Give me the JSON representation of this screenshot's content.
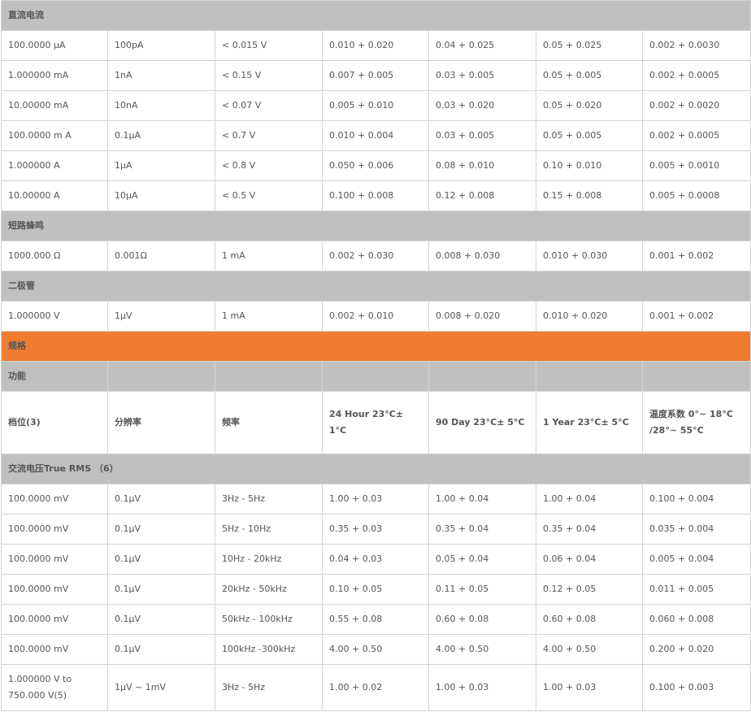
{
  "sections": {
    "dc_current": "直流电流",
    "continuity": "短路蜂鸣",
    "diode": "二极管",
    "spec": "规格",
    "function": "功能",
    "ac_voltage": "交流电压True RMS （6）"
  },
  "dc_current_rows": [
    [
      "100.0000 μA",
      "100pA",
      "< 0.015 V",
      "0.010 + 0.020",
      "0.04 + 0.025",
      "0.05 + 0.025",
      "0.002 + 0.0030"
    ],
    [
      "1.000000 mA",
      "1nA",
      "< 0.15 V",
      "0.007 + 0.005",
      "0.03 + 0.005",
      "0.05 + 0.005",
      "0.002 + 0.0005"
    ],
    [
      "10.00000 mA",
      "10nA",
      "< 0.07 V",
      "0.005 + 0.010",
      "0.03 + 0.020",
      "0.05 + 0.020",
      "0.002 + 0.0020"
    ],
    [
      "100.0000 m A",
      "0.1μA",
      "< 0.7 V",
      "0.010 + 0.004",
      "0.03 + 0.005",
      "0.05 + 0.005",
      "0.002 + 0.0005"
    ],
    [
      "1.000000 A",
      "1μA",
      "< 0.8 V",
      "0.050 + 0.006",
      "0.08 + 0.010",
      "0.10 + 0.010",
      "0.005 + 0.0010"
    ],
    [
      "10.00000 A",
      "10μA",
      "< 0.5 V",
      "0.100 + 0.008",
      "0.12 + 0.008",
      "0.15 + 0.008",
      "0.005 + 0.0008"
    ]
  ],
  "continuity_rows": [
    [
      "1000.000 Ω",
      "0.001Ω",
      "1 mA",
      "0.002 + 0.030",
      "0.008 + 0.030",
      "0.010 + 0.030",
      "0.001 + 0.002"
    ]
  ],
  "diode_rows": [
    [
      "1.000000 V",
      "1μV",
      "1 mA",
      "0.002 + 0.010",
      "0.008 + 0.020",
      "0.010 + 0.020",
      "0.001 + 0.002"
    ]
  ],
  "column_headers": [
    "档位(3)",
    "分辨率",
    "频率",
    "24 Hour 23°C± 1°C",
    "90 Day 23°C± 5°C",
    "1 Year 23°C± 5°C",
    "温度系数 0°~ 18°C /28°~ 55°C"
  ],
  "ac_voltage_rows": [
    [
      "100.0000 mV",
      "0.1μV",
      "3Hz - 5Hz",
      "1.00 + 0.03",
      "1.00 + 0.04",
      "1.00 + 0.04",
      "0.100 + 0.004"
    ],
    [
      "100.0000 mV",
      "0.1μV",
      "5Hz - 10Hz",
      "0.35 + 0.03",
      "0.35 + 0.04",
      "0.35 + 0.04",
      "0.035 + 0.004"
    ],
    [
      "100.0000 mV",
      "0.1μV",
      "10Hz - 20kHz",
      "0.04 + 0.03",
      "0.05 + 0.04",
      "0.06 + 0.04",
      "0.005 + 0.004"
    ],
    [
      "100.0000 mV",
      "0.1μV",
      "20kHz - 50kHz",
      "0.10 + 0.05",
      "0.11 + 0.05",
      "0.12 + 0.05",
      "0.011 + 0.005"
    ],
    [
      "100.0000 mV",
      "0.1μV",
      "50kHz - 100kHz",
      "0.55 + 0.08",
      "0.60 + 0.08",
      "0.60 + 0.08",
      "0.060 + 0.008"
    ],
    [
      "100.0000 mV",
      "0.1μV",
      "100kHz -300kHz",
      "4.00 + 0.50",
      "4.00 + 0.50",
      "4.00 + 0.50",
      "0.200 + 0.020"
    ],
    [
      "1.000000 V to 750.000 V(5)",
      "1μV ~ 1mV",
      "3Hz - 5Hz",
      "1.00 + 0.02",
      "1.00 + 0.03",
      "1.00 + 0.03",
      "0.100 + 0.003"
    ]
  ]
}
